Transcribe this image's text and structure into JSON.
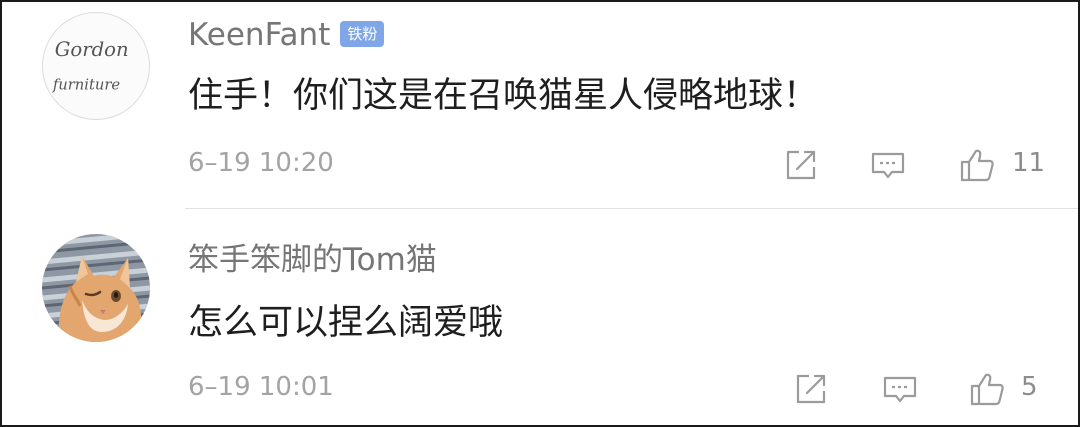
{
  "comments": [
    {
      "username": "KeenFant",
      "badge": "铁粉",
      "text": "住手！你们这是在召唤猫星人侵略地球！",
      "time": "6–19 10:20",
      "likes": "11",
      "avatar_lines": [
        "Gordon",
        "furniture"
      ],
      "icons": [
        "repost-icon",
        "reply-icon",
        "thumbs-up-icon"
      ]
    },
    {
      "username": "笨手笨脚的Tom猫",
      "text": "怎么可以捏么阔爱哦",
      "time": "6–19 10:01",
      "likes": "5",
      "icons": [
        "repost-icon",
        "reply-icon",
        "thumbs-up-icon"
      ]
    }
  ],
  "colors": {
    "username": "#767676",
    "text": "#1e1e1e",
    "meta": "#a3a3a3",
    "badge": "#7fa6e6",
    "icon": "#9b9b9b"
  }
}
